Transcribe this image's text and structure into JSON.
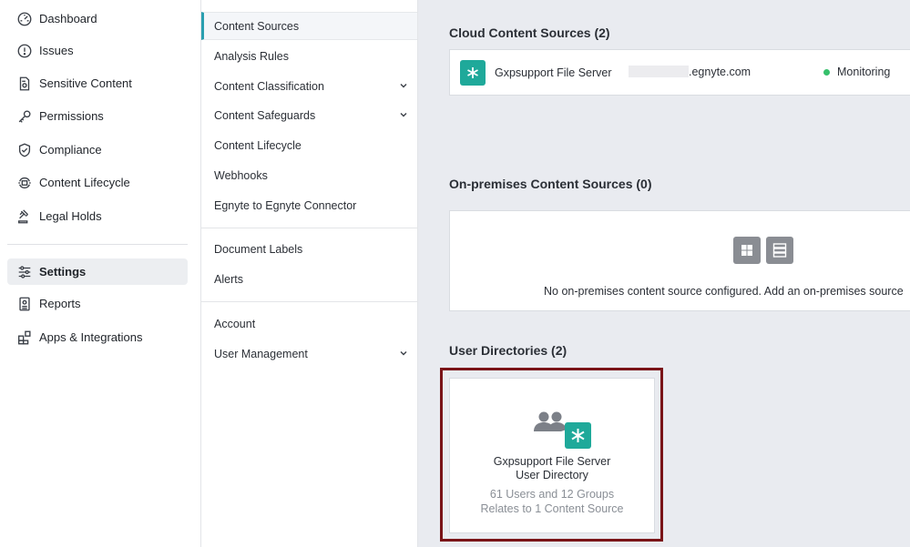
{
  "left_nav": {
    "items": [
      {
        "label": "Dashboard",
        "icon": "dashboard-gauge-icon"
      },
      {
        "label": "Issues",
        "icon": "alert-circle-icon"
      },
      {
        "label": "Sensitive Content",
        "icon": "sensitive-document-icon"
      },
      {
        "label": "Permissions",
        "icon": "key-icon"
      },
      {
        "label": "Compliance",
        "icon": "shield-check-icon"
      },
      {
        "label": "Content Lifecycle",
        "icon": "lifecycle-icon"
      },
      {
        "label": "Legal Holds",
        "icon": "gavel-icon"
      },
      {
        "label": "Settings",
        "icon": "sliders-icon",
        "active": true
      },
      {
        "label": "Reports",
        "icon": "report-icon"
      },
      {
        "label": "Apps & Integrations",
        "icon": "apps-icon"
      }
    ]
  },
  "sub_nav": {
    "items": [
      {
        "label": "Content Sources",
        "active": true
      },
      {
        "label": "Analysis Rules"
      },
      {
        "label": "Content Classification",
        "expandable": true
      },
      {
        "label": "Content Safeguards",
        "expandable": true
      },
      {
        "label": "Content Lifecycle"
      },
      {
        "label": "Webhooks"
      },
      {
        "label": "Egnyte to Egnyte Connector"
      },
      {
        "label": "Document Labels"
      },
      {
        "label": "Alerts"
      },
      {
        "label": "Account"
      },
      {
        "label": "User Management",
        "expandable": true
      }
    ]
  },
  "main": {
    "cloud": {
      "title": "Cloud Content Sources (2)",
      "source_name": "Gxpsupport File Server",
      "source_url_suffix": ".egnyte.com",
      "status": "Monitoring",
      "status_color": "#35c06b"
    },
    "onprem": {
      "title": "On-premises Content Sources (0)",
      "message": "No on-premises content source configured. Add an on-premises source"
    },
    "directories": {
      "title": "User Directories (2)",
      "card": {
        "name_line1": "Gxpsupport File Server",
        "name_line2": "User Directory",
        "stats": "61 Users and 12 Groups",
        "relation": "Relates to 1 Content Source"
      }
    }
  },
  "colors": {
    "accent": "#2a9fb0",
    "egnyte_green": "#1fa99a",
    "highlight_border": "#7a1418",
    "main_bg": "#e9ebf0"
  }
}
